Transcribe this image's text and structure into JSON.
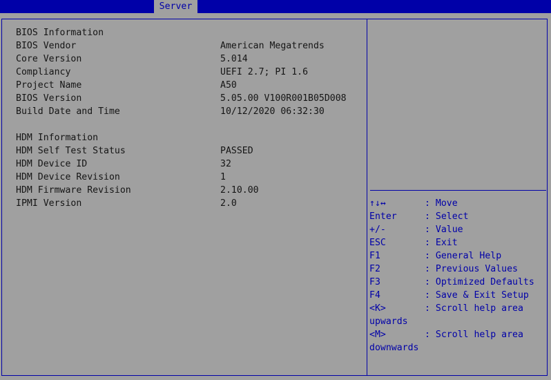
{
  "tabs": {
    "server": "Server"
  },
  "info": {
    "bios_heading": "BIOS Information",
    "rows": [
      {
        "label": "BIOS Vendor",
        "value": "American Megatrends"
      },
      {
        "label": "Core Version",
        "value": "5.014"
      },
      {
        "label": "Compliancy",
        "value": "UEFI 2.7; PI 1.6"
      },
      {
        "label": "Project Name",
        "value": "A50"
      },
      {
        "label": "BIOS Version",
        "value": "5.05.00 V100R001B05D008"
      },
      {
        "label": "Build Date and Time",
        "value": "10/12/2020 06:32:30"
      }
    ],
    "hdm_heading": "HDM Information",
    "hdm_rows": [
      {
        "label": "HDM Self Test Status",
        "value": "PASSED"
      },
      {
        "label": "HDM Device ID",
        "value": "32"
      },
      {
        "label": "HDM Device Revision",
        "value": "1"
      },
      {
        "label": "HDM Firmware Revision",
        "value": "2.10.00"
      },
      {
        "label": "IPMI Version",
        "value": "2.0"
      }
    ]
  },
  "help": {
    "keys": [
      {
        "key": "↑↓↔",
        "desc": ": Move"
      },
      {
        "key": "Enter",
        "desc": ": Select"
      },
      {
        "key": "+/-",
        "desc": ": Value"
      },
      {
        "key": "ESC",
        "desc": ": Exit"
      },
      {
        "key": "F1",
        "desc": ": General Help"
      },
      {
        "key": "F2",
        "desc": ": Previous Values"
      },
      {
        "key": "F3",
        "desc": ": Optimized Defaults"
      },
      {
        "key": "F4",
        "desc": ": Save & Exit Setup"
      },
      {
        "key": "<K>",
        "desc": ": Scroll help area",
        "cont": "upwards"
      },
      {
        "key": "<M>",
        "desc": ": Scroll help area",
        "cont": "downwards"
      }
    ]
  },
  "colors": {
    "background": "#a0a0a0",
    "accent_blue": "#0000a8",
    "text": "#151515"
  }
}
